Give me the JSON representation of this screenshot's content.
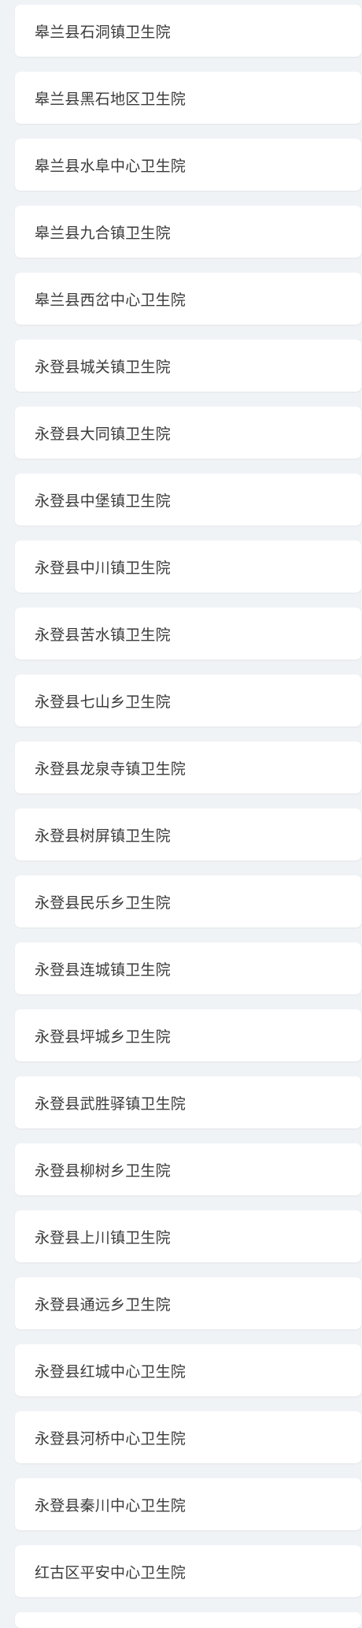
{
  "hospitals": {
    "items": [
      {
        "label": "皋兰县石洞镇卫生院"
      },
      {
        "label": "皋兰县黑石地区卫生院"
      },
      {
        "label": "皋兰县水阜中心卫生院"
      },
      {
        "label": "皋兰县九合镇卫生院"
      },
      {
        "label": "皋兰县西岔中心卫生院"
      },
      {
        "label": "永登县城关镇卫生院"
      },
      {
        "label": "永登县大同镇卫生院"
      },
      {
        "label": "永登县中堡镇卫生院"
      },
      {
        "label": "永登县中川镇卫生院"
      },
      {
        "label": "永登县苦水镇卫生院"
      },
      {
        "label": "永登县七山乡卫生院"
      },
      {
        "label": "永登县龙泉寺镇卫生院"
      },
      {
        "label": "永登县树屏镇卫生院"
      },
      {
        "label": "永登县民乐乡卫生院"
      },
      {
        "label": "永登县连城镇卫生院"
      },
      {
        "label": "永登县坪城乡卫生院"
      },
      {
        "label": "永登县武胜驿镇卫生院"
      },
      {
        "label": "永登县柳树乡卫生院"
      },
      {
        "label": "永登县上川镇卫生院"
      },
      {
        "label": "永登县通远乡卫生院"
      },
      {
        "label": "永登县红城中心卫生院"
      },
      {
        "label": "永登县河桥中心卫生院"
      },
      {
        "label": "永登县秦川中心卫生院"
      },
      {
        "label": "红古区平安中心卫生院"
      }
    ]
  }
}
